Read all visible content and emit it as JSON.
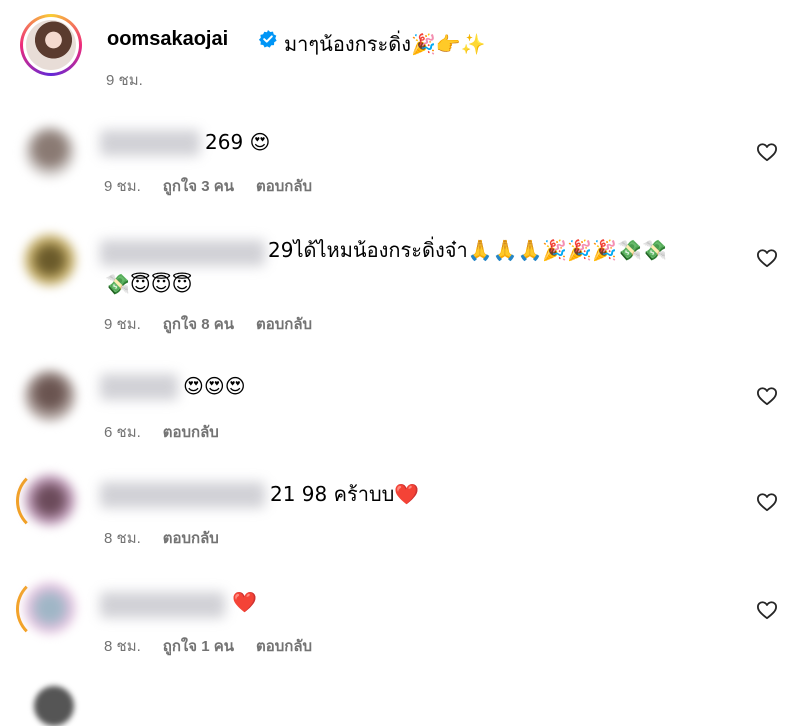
{
  "caption": {
    "username": "oomsakaojai",
    "text": "มาๆน้องกระดิ่ง🎉👉✨",
    "time": "9 ชม."
  },
  "labels": {
    "reply": "ตอบกลับ"
  },
  "comments": [
    {
      "text": "269 😍",
      "time": "9 ชม.",
      "likes": "ถูกใจ 3 คน",
      "reply": "ตอบกลับ"
    },
    {
      "text": "29ได้ไหมน้องกระดิ่งจ๋า🙏🙏🙏🎉🎉🎉💸💸",
      "text_line2": "💸😇😇😇",
      "time": "9 ชม.",
      "likes": "ถูกใจ 8 คน",
      "reply": "ตอบกลับ"
    },
    {
      "text": "😍😍😍",
      "time": "6 ชม.",
      "reply": "ตอบกลับ"
    },
    {
      "text": "21 98 คร้าบบ❤️",
      "time": "8 ชม.",
      "reply": "ตอบกลับ"
    },
    {
      "text": "❤️",
      "time": "8 ชม.",
      "likes": "ถูกใจ 1 คน",
      "reply": "ตอบกลับ"
    }
  ],
  "colors": {
    "meta_text": "#737373",
    "verified": "#0095f6",
    "heart_red": "#e0245e"
  },
  "icons": {
    "verified": "verified-badge-icon",
    "like": "heart-outline-icon"
  }
}
